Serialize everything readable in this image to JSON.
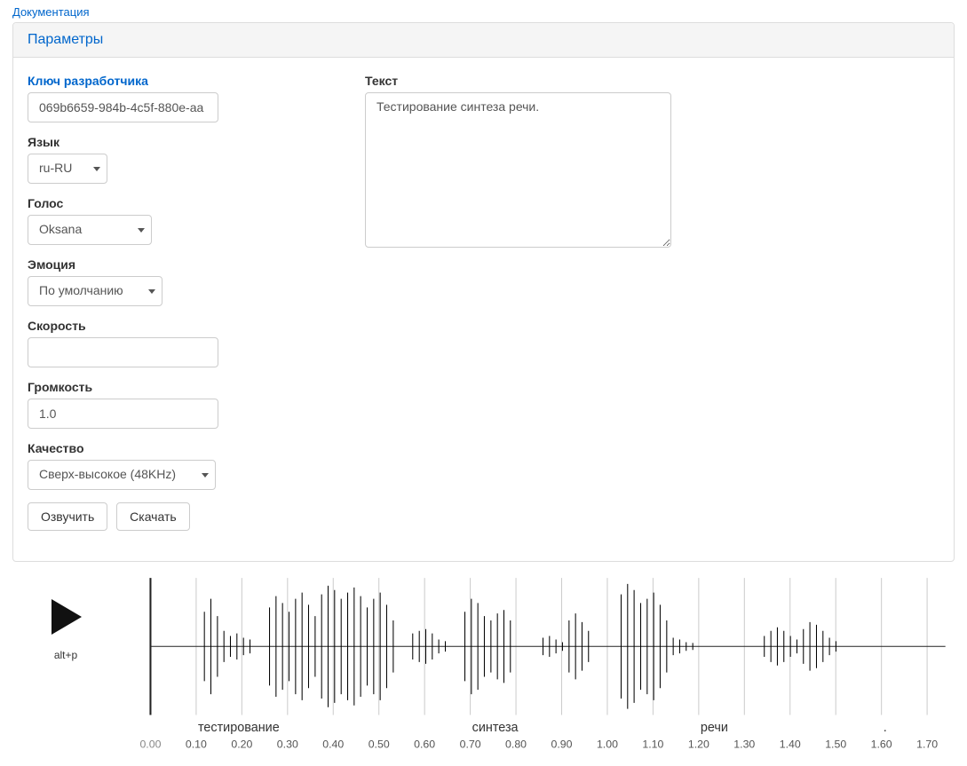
{
  "nav": {
    "documentation": "Документация"
  },
  "panel": {
    "title": "Параметры"
  },
  "form": {
    "api_key_label": "Ключ разработчика",
    "api_key_value": "069b6659-984b-4c5f-880e-aa",
    "language_label": "Язык",
    "language_value": "ru-RU",
    "voice_label": "Голос",
    "voice_value": "Oksana",
    "emotion_label": "Эмоция",
    "emotion_value": "По умолчанию",
    "speed_label": "Скорость",
    "speed_value": "",
    "volume_label": "Громкость",
    "volume_value": "1.0",
    "quality_label": "Качество",
    "quality_value": "Сверх-высокое (48KHz)",
    "text_label": "Текст",
    "text_value": "Тестирование синтеза речи.",
    "synth_btn": "Озвучить",
    "download_btn": "Скачать"
  },
  "player": {
    "hotkey": "alt+p",
    "ticks": [
      "0.00",
      "0.10",
      "0.20",
      "0.30",
      "0.40",
      "0.50",
      "0.60",
      "0.70",
      "0.80",
      "0.90",
      "1.00",
      "1.10",
      "1.20",
      "1.30",
      "1.40",
      "1.50",
      "1.60",
      "1.70"
    ],
    "words": [
      {
        "label": "тестирование",
        "start_idx": 1
      },
      {
        "label": "синтеза",
        "start_idx": 7
      },
      {
        "label": "речи",
        "start_idx": 12
      },
      {
        "label": ".",
        "start_idx": 16
      }
    ],
    "amplitude": [
      0,
      0,
      0,
      0,
      0,
      0,
      0,
      0,
      40,
      55,
      35,
      18,
      12,
      15,
      10,
      8,
      0,
      0,
      45,
      58,
      50,
      40,
      55,
      62,
      48,
      35,
      60,
      70,
      65,
      55,
      62,
      68,
      58,
      45,
      55,
      62,
      48,
      30,
      0,
      0,
      15,
      18,
      20,
      15,
      8,
      6,
      0,
      0,
      40,
      55,
      50,
      35,
      30,
      38,
      42,
      30,
      0,
      0,
      0,
      0,
      10,
      12,
      8,
      5,
      30,
      38,
      28,
      18,
      0,
      0,
      0,
      0,
      60,
      72,
      65,
      50,
      55,
      62,
      48,
      30,
      10,
      8,
      5,
      4,
      0,
      0,
      0,
      0,
      0,
      0,
      0,
      0,
      0,
      0,
      12,
      18,
      22,
      18,
      12,
      8,
      20,
      28,
      25,
      18,
      10,
      6,
      0,
      0,
      0,
      0,
      0,
      0,
      0,
      0,
      0,
      0,
      0,
      0,
      0,
      0
    ]
  }
}
